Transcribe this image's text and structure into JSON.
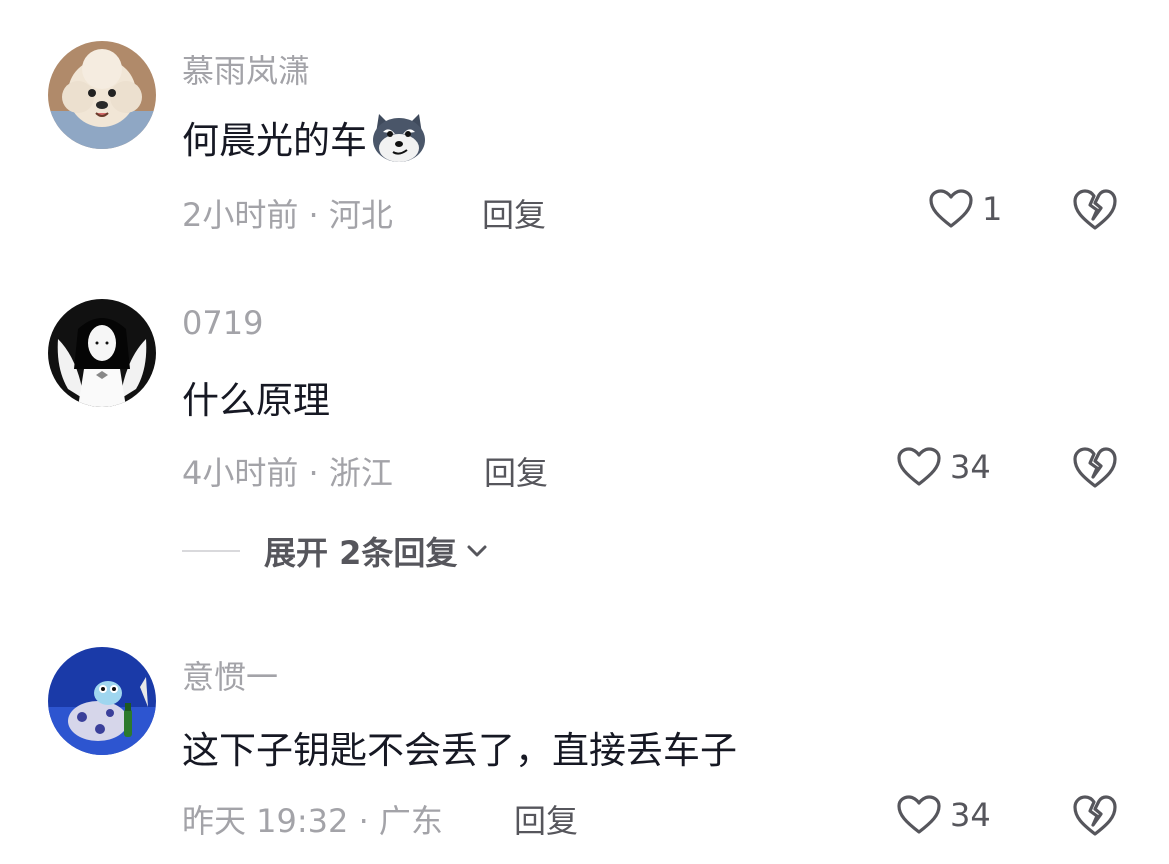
{
  "comments": [
    {
      "username": "慕雨岚潇",
      "text": "何晨光的车",
      "emoji": "husky-face-emoji",
      "meta": "2小时前 · 河北",
      "reply_label": "回复",
      "likes": "1",
      "avatar": "poodle-avatar"
    },
    {
      "username": "0719",
      "text": "什么原理",
      "meta": "4小时前 · 浙江",
      "reply_label": "回复",
      "likes": "34",
      "avatar": "angel-girl-avatar",
      "expand_label": "展开 2条回复"
    },
    {
      "username": "意惯一",
      "text": "这下子钥匙不会丢了，直接丢车子",
      "meta": "昨天 19:32 · 广东",
      "reply_label": "回复",
      "likes": "34",
      "avatar": "frog-cartoon-avatar"
    }
  ],
  "colors": {
    "username": "#a3a3a8",
    "text": "#161823",
    "secondary": "#56565c"
  }
}
